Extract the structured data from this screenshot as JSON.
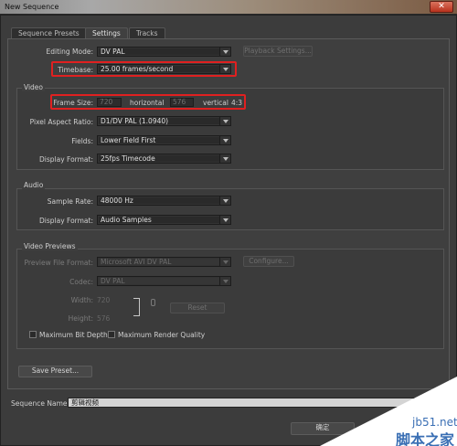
{
  "window": {
    "title": "New Sequence",
    "close_glyph": "✕"
  },
  "tabs": [
    {
      "label": "Sequence Presets",
      "active": false
    },
    {
      "label": "Settings",
      "active": true
    },
    {
      "label": "Tracks",
      "active": false
    }
  ],
  "general": {
    "editing_mode_label": "Editing Mode:",
    "editing_mode_value": "DV PAL",
    "playback_settings_label": "Playback Settings...",
    "timebase_label": "Timebase:",
    "timebase_value": "25.00 frames/second"
  },
  "video": {
    "title": "Video",
    "frame_size_label": "Frame Size:",
    "frame_width": "720",
    "horizontal_label": "horizontal",
    "frame_height": "576",
    "vertical_label": "vertical",
    "aspect": "4:3",
    "pixel_aspect_label": "Pixel Aspect Ratio:",
    "pixel_aspect_value": "D1/DV PAL (1.0940)",
    "fields_label": "Fields:",
    "fields_value": "Lower Field First",
    "display_format_label": "Display Format:",
    "display_format_value": "25fps Timecode"
  },
  "audio": {
    "title": "Audio",
    "sample_rate_label": "Sample Rate:",
    "sample_rate_value": "48000 Hz",
    "display_format_label": "Display Format:",
    "display_format_value": "Audio Samples"
  },
  "previews": {
    "title": "Video Previews",
    "file_format_label": "Preview File Format:",
    "file_format_value": "Microsoft AVI DV PAL",
    "configure_label": "Configure...",
    "codec_label": "Codec:",
    "codec_value": "DV PAL",
    "width_label": "Width:",
    "width_value": "720",
    "height_label": "Height:",
    "height_value": "576",
    "reset_label": "Reset",
    "max_bit_depth_label": "Maximum Bit Depth",
    "max_render_quality_label": "Maximum Render Quality"
  },
  "save_preset_label": "Save Preset...",
  "sequence_name_label": "Sequence Name:",
  "sequence_name_value": "剪辑视频",
  "ok_label": "确定",
  "watermark": {
    "site": "jb51.net",
    "name": "脚本之家"
  },
  "colors": {
    "highlight": "#e02020",
    "watermark": "#3a6fb4"
  }
}
